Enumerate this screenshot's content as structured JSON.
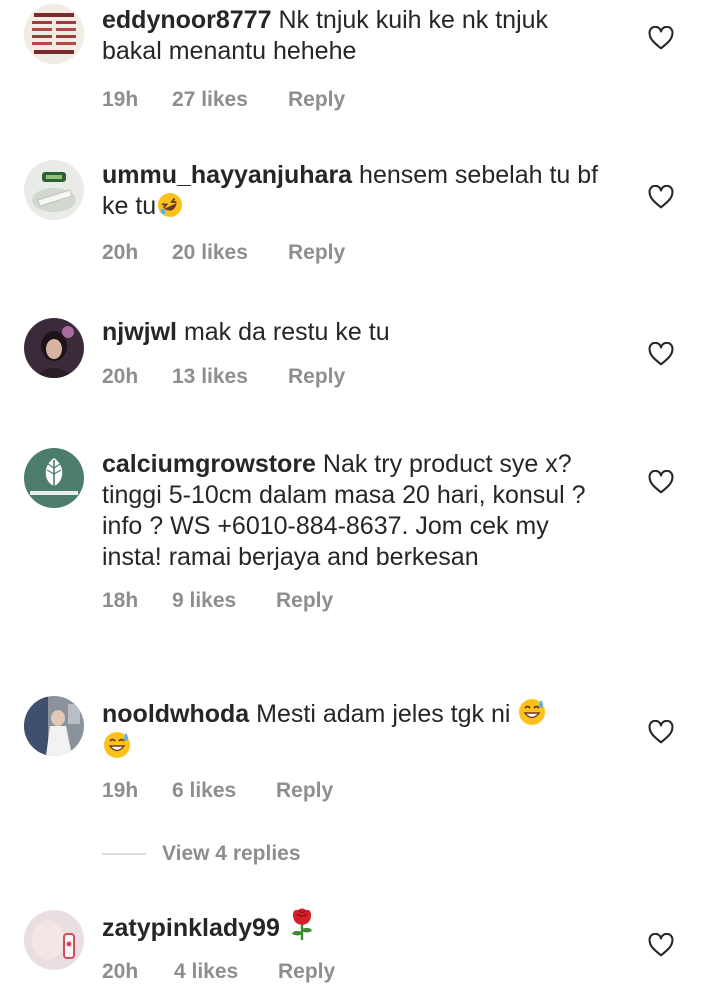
{
  "comments": [
    {
      "username": "eddynoor8777",
      "text": "Nk tnjuk kuih ke nk tnjuk bakal menantu hehehe",
      "time": "19h",
      "likes": "27 likes",
      "reply": "Reply"
    },
    {
      "username": "ummu_hayyanjuhara",
      "text": "hensem sebelah tu bf ke tu",
      "emoji": "rofl-emoji",
      "time": "20h",
      "likes": "20 likes",
      "reply": "Reply"
    },
    {
      "username": "njwjwl",
      "text": "mak da restu ke tu",
      "time": "20h",
      "likes": "13 likes",
      "reply": "Reply"
    },
    {
      "username": "calciumgrowstore",
      "text": "Nak try product sye x? tinggi 5-10cm dalam masa 20 hari, konsul ? info ? WS +6010-884-8637. Jom cek my insta! ramai berjaya and berkesan",
      "time": "18h",
      "likes": "9 likes",
      "reply": "Reply"
    },
    {
      "username": "nooldwhoda",
      "text": "Mesti adam jeles tgk ni",
      "emoji": "sweat-smile-emoji",
      "time": "19h",
      "likes": "6 likes",
      "reply": "Reply"
    },
    {
      "username": "zatypinklady99",
      "text": "",
      "emoji": "rose-emoji",
      "time": "20h",
      "likes": "4 likes",
      "reply": "Reply"
    }
  ],
  "view_replies": "View 4 replies",
  "colors": {
    "text": "#262626",
    "meta": "#8e8e8e",
    "divider": "#dbdbdb",
    "heart": "#262626"
  }
}
